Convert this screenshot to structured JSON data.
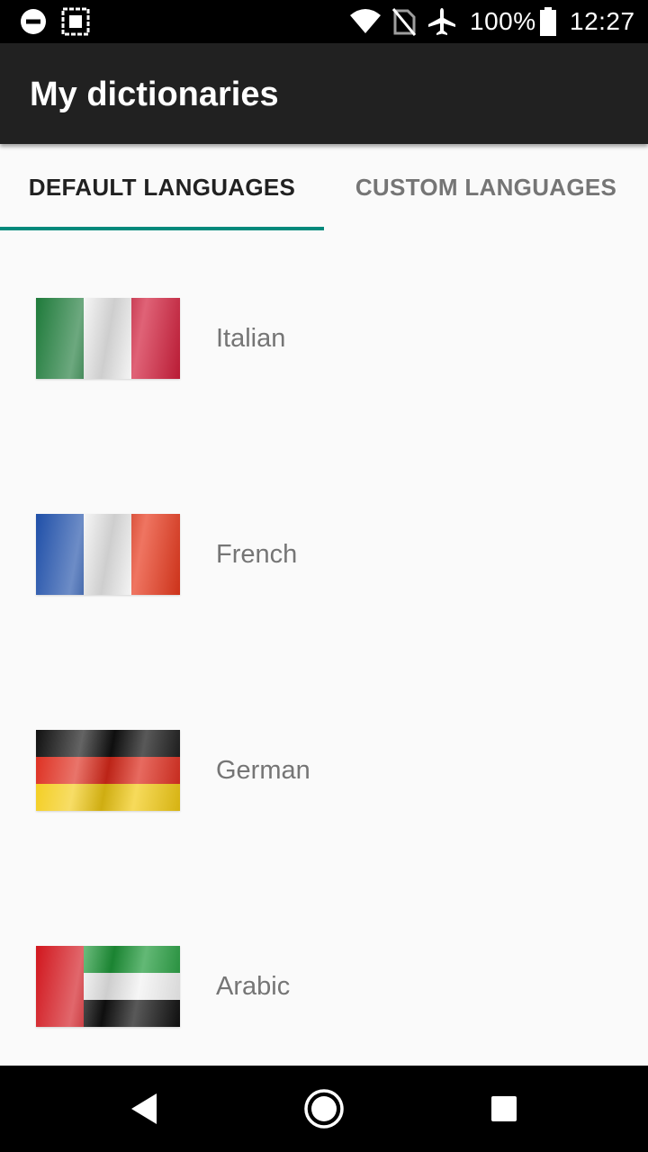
{
  "status_bar": {
    "battery": "100%",
    "time": "12:27",
    "icons": [
      "dnd-icon",
      "app-notification-icon",
      "wifi-icon",
      "no-sim-icon",
      "airplane-icon",
      "battery-icon"
    ]
  },
  "app_bar": {
    "title": "My dictionaries"
  },
  "tabs": [
    {
      "label": "DEFAULT LANGUAGES",
      "selected": true
    },
    {
      "label": "CUSTOM LANGUAGES",
      "selected": false
    }
  ],
  "colors": {
    "tab_indicator": "#00897b",
    "app_bar": "#212121",
    "background": "#fafafa"
  },
  "languages": [
    {
      "name": "Italian",
      "flag": "italy-flag-icon"
    },
    {
      "name": "French",
      "flag": "france-flag-icon"
    },
    {
      "name": "German",
      "flag": "germany-flag-icon"
    },
    {
      "name": "Arabic",
      "flag": "uae-flag-icon"
    }
  ],
  "nav_bar": {
    "icons": [
      "back-icon",
      "home-icon",
      "recents-icon"
    ]
  }
}
